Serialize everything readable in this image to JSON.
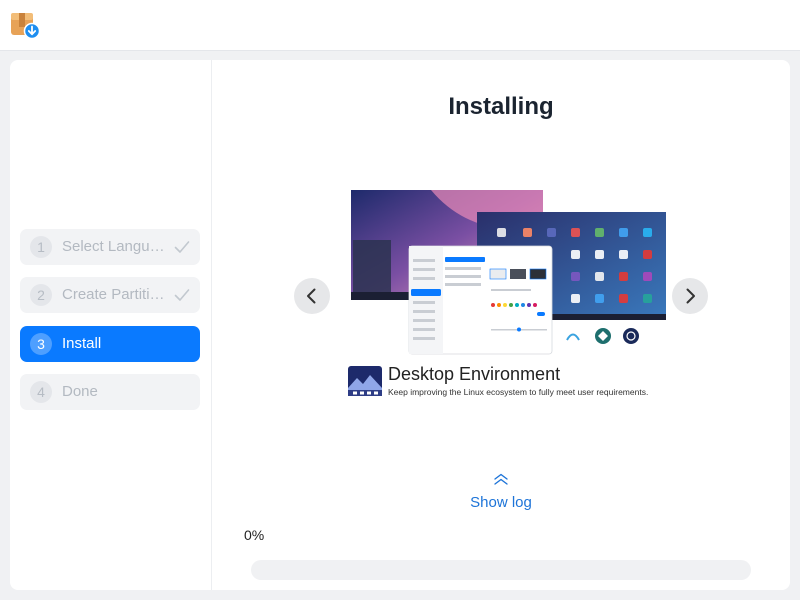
{
  "sidebar": {
    "steps": [
      {
        "number": "1",
        "label": "Select Language",
        "state": "done"
      },
      {
        "number": "2",
        "label": "Create Partitions",
        "state": "done"
      },
      {
        "number": "3",
        "label": "Install",
        "state": "active"
      },
      {
        "number": "4",
        "label": "Done",
        "state": "pending"
      }
    ]
  },
  "main": {
    "title": "Installing",
    "slide": {
      "title": "Desktop Environment",
      "subtitle": "Keep improving the Linux ecosystem to fully meet user requirements."
    },
    "show_log_label": "Show log",
    "progress": {
      "percent": 0,
      "label": "0%"
    }
  },
  "colors": {
    "accent": "#0a7aff",
    "link": "#1d74d8"
  },
  "icons": {
    "app": "installer-package-icon",
    "step_done": "check-icon",
    "prev": "chevron-left-icon",
    "next": "chevron-right-icon",
    "log": "double-chevron-up-icon"
  }
}
